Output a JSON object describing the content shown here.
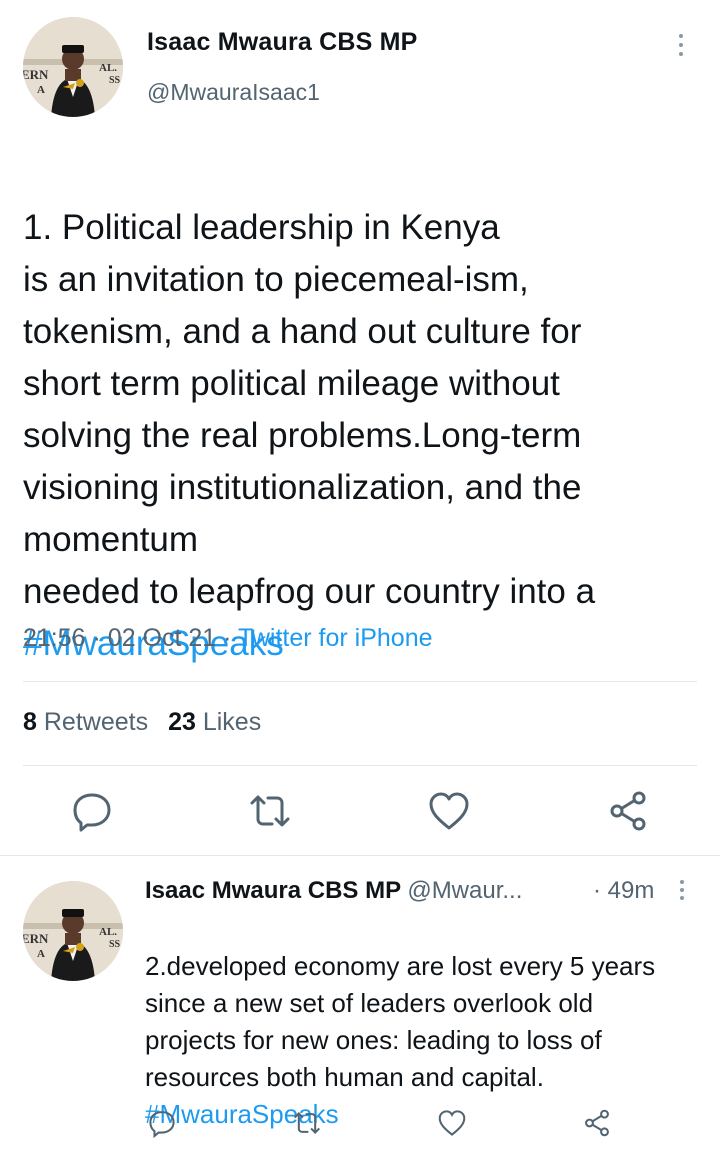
{
  "tweet": {
    "author_name": "Isaac Mwaura CBS MP",
    "author_handle": "@MwauraIsaac1",
    "avatar_text_left": "ERN\nA",
    "avatar_text_right": "AL.\nSS",
    "text": "1. Political leadership in Kenya\nis an invitation to piecemeal-ism,\ntokenism, and a hand out culture for\nshort term political mileage without\nsolving the real  problems.Long-term\nvisioning institutionalization, and the\nmomentum\nneeded to leapfrog our country into a",
    "hashtag": "#MwauraSpeaks",
    "time": "21:56",
    "date": "02 Oct 21",
    "source": "Twitter for iPhone",
    "meta_sep": "·",
    "retweets_count": "8",
    "retweets_label": "Retweets",
    "likes_count": "23",
    "likes_label": "Likes"
  },
  "actions": [
    {
      "name": "reply-icon"
    },
    {
      "name": "retweet-icon"
    },
    {
      "name": "like-icon"
    },
    {
      "name": "share-icon"
    }
  ],
  "reply_tweet": {
    "author_name": "Isaac Mwaura CBS MP",
    "author_handle": "@Mwaur...",
    "time": "· 49m",
    "text": "2.developed economy are lost every 5 years\nsince a new set of leaders overlook old\nprojects for new ones: leading to loss of\nresources both human and capital.",
    "hashtag": "#MwauraSpeaks"
  },
  "colors": {
    "accent": "#1d9bf0",
    "secondary_text": "#536471",
    "icon": "#536471",
    "divider": "#e1e8ed"
  }
}
